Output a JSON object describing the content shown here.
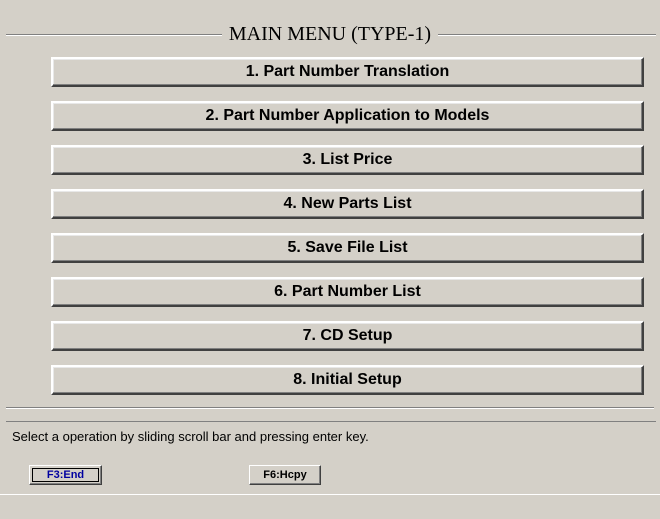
{
  "main_menu": {
    "title": "MAIN MENU (TYPE-1)",
    "items": [
      {
        "label": "1. Part Number Translation"
      },
      {
        "label": "2. Part Number Application to Models"
      },
      {
        "label": "3. List Price"
      },
      {
        "label": "4. New Parts List"
      },
      {
        "label": "5. Save File List"
      },
      {
        "label": "6. Part Number List"
      },
      {
        "label": "7. CD Setup"
      },
      {
        "label": "8. Initial Setup"
      }
    ]
  },
  "status": {
    "message": "Select a operation by sliding scroll bar and pressing enter key."
  },
  "function_keys": {
    "end_label": "F3:End",
    "hcpy_label": "F6:Hcpy"
  }
}
